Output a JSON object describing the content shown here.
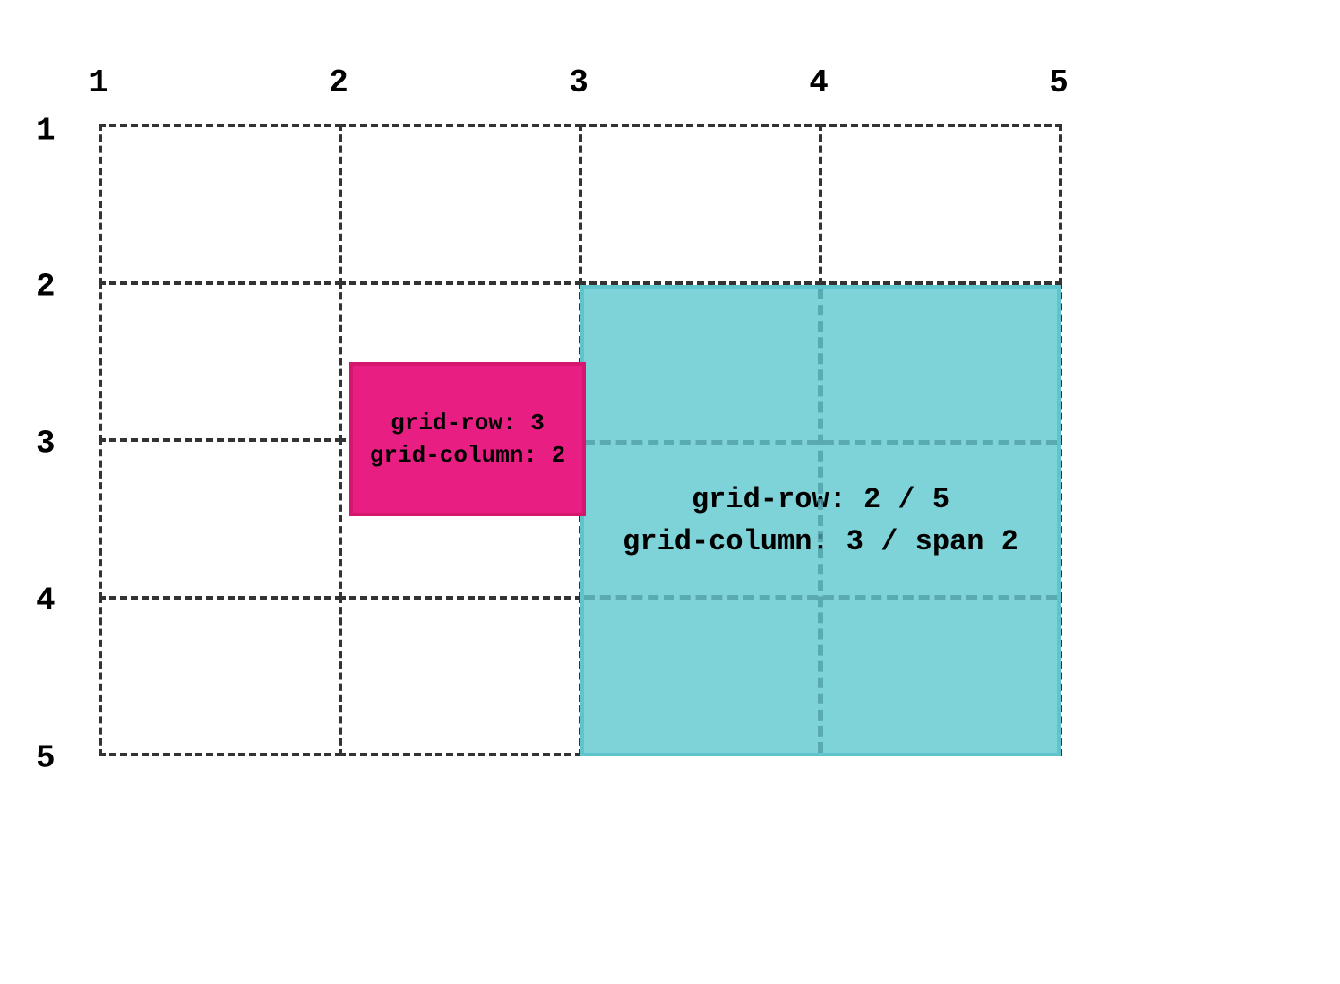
{
  "grid": {
    "column_lines": [
      "1",
      "2",
      "3",
      "4",
      "5"
    ],
    "row_lines": [
      "1",
      "2",
      "3",
      "4",
      "5"
    ],
    "columns": 4,
    "rows": 4
  },
  "items": {
    "pink": {
      "lines": [
        "grid-row: 3",
        "grid-column: 2"
      ],
      "color": "#e91e82"
    },
    "teal": {
      "lines": [
        "grid-row: 2 / 5",
        "grid-column: 3 / span 2"
      ],
      "color": "#7dd3d8"
    }
  }
}
